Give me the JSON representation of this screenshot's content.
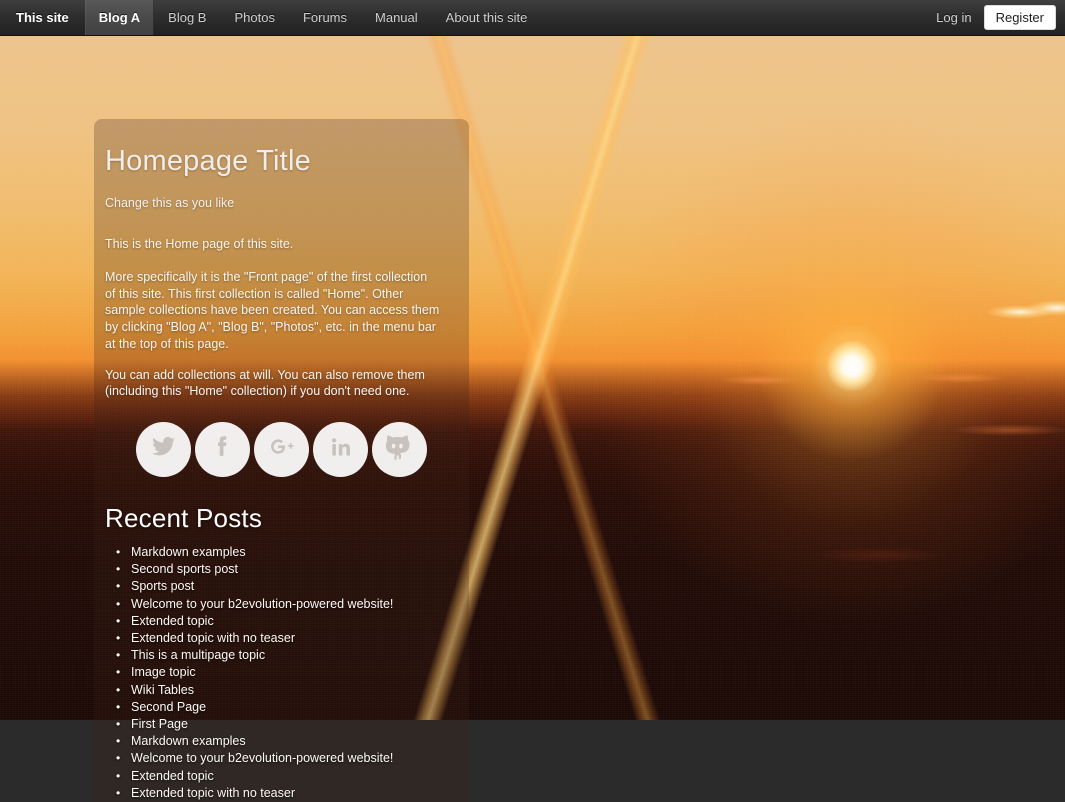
{
  "navbar": {
    "brand": "This site",
    "items": [
      {
        "label": "Blog A",
        "active": true
      },
      {
        "label": "Blog B",
        "active": false
      },
      {
        "label": "Photos",
        "active": false
      },
      {
        "label": "Forums",
        "active": false
      },
      {
        "label": "Manual",
        "active": false
      },
      {
        "label": "About this site",
        "active": false
      }
    ],
    "login_label": "Log in",
    "register_label": "Register",
    "background_color": "#2e2e2e",
    "active_background_color": "#4a4a4a",
    "register_background_color": "#ffffff"
  },
  "panel": {
    "title": "Homepage Title",
    "subtitle": "Change this as you like",
    "paragraphs": [
      "This is the Home page of this site.",
      "More specifically it is the \"Front page\" of the first collection of this site. This first collection is called \"Home\". Other sample collections have been created. You can access them by clicking \"Blog A\", \"Blog B\", \"Photos\", etc. in the menu bar at the top of this page.",
      "You can add collections at will. You can also remove them (including this \"Home\" collection) if you don't need one."
    ]
  },
  "social": {
    "items": [
      {
        "name": "twitter",
        "label": "Twitter"
      },
      {
        "name": "facebook",
        "label": "Facebook"
      },
      {
        "name": "google-plus",
        "label": "Google Plus"
      },
      {
        "name": "linkedin",
        "label": "LinkedIn"
      },
      {
        "name": "github",
        "label": "GitHub"
      }
    ],
    "circle_color": "#ffffff",
    "glyph_color": "#c7c2bd"
  },
  "recent_posts": {
    "title": "Recent Posts",
    "items": [
      "Markdown examples",
      "Second sports post",
      "Sports post",
      "Welcome to your b2evolution-powered website!",
      "Extended topic",
      "Extended topic with no teaser",
      "This is a multipage topic",
      "Image topic",
      "Wiki Tables",
      "Second Page",
      "First Page",
      "Markdown examples",
      "Welcome to your b2evolution-powered website!",
      "Extended topic",
      "Extended topic with no teaser"
    ]
  },
  "background": {
    "description": "sunset-photo",
    "sky_top_color": "#e9c191",
    "sky_mid_color": "#f2a23c",
    "horizon_color": "#ee6b1d",
    "foreground_color": "#1d0a05",
    "sun_color": "#ffffff"
  }
}
